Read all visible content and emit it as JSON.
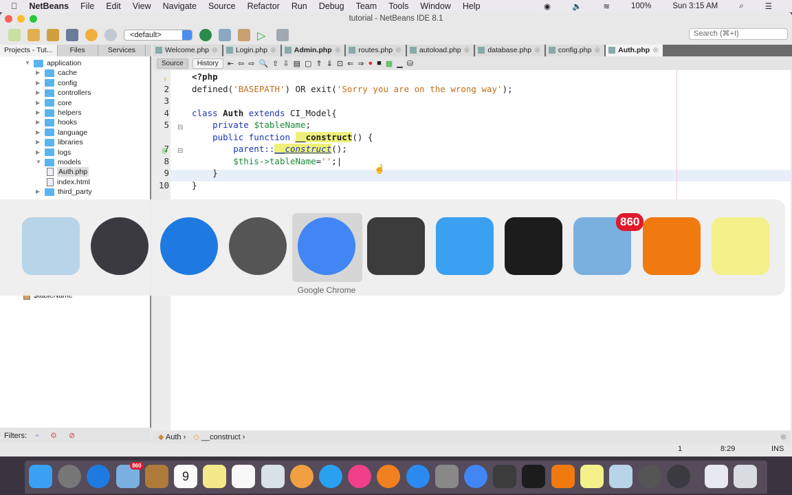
{
  "menubar": {
    "app": "NetBeans",
    "items": [
      "File",
      "Edit",
      "View",
      "Navigate",
      "Source",
      "Refactor",
      "Run",
      "Debug",
      "Team",
      "Tools",
      "Window",
      "Help"
    ],
    "battery": "100%",
    "clock": "Sun 3:15 AM"
  },
  "window": {
    "title": "tutorial - NetBeans IDE 8.1"
  },
  "toolbar": {
    "config": "<default>",
    "search_placeholder": "Search (⌘+I)"
  },
  "left_tabs": [
    "Projects - Tut...",
    "Files",
    "Services"
  ],
  "tree": [
    {
      "label": "application",
      "type": "folder",
      "depth": 0,
      "open": true
    },
    {
      "label": "cache",
      "type": "folder",
      "depth": 1
    },
    {
      "label": "config",
      "type": "folder",
      "depth": 1
    },
    {
      "label": "controllers",
      "type": "folder",
      "depth": 1
    },
    {
      "label": "core",
      "type": "folder",
      "depth": 1
    },
    {
      "label": "helpers",
      "type": "folder",
      "depth": 1
    },
    {
      "label": "hooks",
      "type": "folder",
      "depth": 1
    },
    {
      "label": "language",
      "type": "folder",
      "depth": 1
    },
    {
      "label": "libraries",
      "type": "folder",
      "depth": 1
    },
    {
      "label": "logs",
      "type": "folder",
      "depth": 1
    },
    {
      "label": "models",
      "type": "folder",
      "depth": 1,
      "open": true
    },
    {
      "label": "Auth.php",
      "type": "file",
      "depth": 2,
      "selected": true
    },
    {
      "label": "index.html",
      "type": "file",
      "depth": 2
    },
    {
      "label": "third_party",
      "type": "folder",
      "depth": 1
    }
  ],
  "navigator": {
    "item": "$tableName"
  },
  "filters_label": "Filters:",
  "editor_tabs": [
    {
      "label": "Welcome.php"
    },
    {
      "label": "Login.php"
    },
    {
      "label": "Admin.php",
      "bold": true
    },
    {
      "label": "routes.php"
    },
    {
      "label": "autoload.php"
    },
    {
      "label": "database.php"
    },
    {
      "label": "config.php"
    },
    {
      "label": "Auth.php",
      "active": true
    }
  ],
  "editor_tools": {
    "source": "Source",
    "history": "History"
  },
  "code": {
    "line_numbers": [
      "",
      "2",
      "3",
      "4",
      "5",
      "",
      "7",
      "8",
      "9",
      "10"
    ],
    "lines": [
      [
        {
          "t": "<?php",
          "c": "b"
        }
      ],
      [
        {
          "t": "defined("
        },
        {
          "t": "'BASEPATH'",
          "c": "str"
        },
        {
          "t": ") OR exit("
        },
        {
          "t": "'Sorry you are on the wrong way'",
          "c": "str"
        },
        {
          "t": ");"
        }
      ],
      [],
      [
        {
          "t": "class ",
          "c": "kw"
        },
        {
          "t": "Auth",
          "c": "b"
        },
        {
          "t": " extends ",
          "c": "kw"
        },
        {
          "t": "CI_Model{"
        }
      ],
      [
        {
          "t": "    private ",
          "c": "kw"
        },
        {
          "t": "$tableName",
          "c": "var"
        },
        {
          "t": ";"
        }
      ],
      [
        {
          "t": "    public function ",
          "c": "kw"
        },
        {
          "t": "__construct",
          "c": "b hl"
        },
        {
          "t": "() {"
        }
      ],
      [
        {
          "t": "        parent::",
          "c": "kw"
        },
        {
          "t": "__construct",
          "c": "kw it hl"
        },
        {
          "t": "();"
        }
      ],
      [
        {
          "t": "        $this->",
          "c": "var"
        },
        {
          "t": "tableName",
          "c": "var"
        },
        {
          "t": "="
        },
        {
          "t": "''",
          "c": "str"
        },
        {
          "t": ";|"
        }
      ],
      [
        {
          "t": "    }"
        }
      ],
      [
        {
          "t": "}"
        }
      ]
    ]
  },
  "breadcrumb": [
    "Auth",
    "__construct"
  ],
  "status": {
    "position": "8:29",
    "mode": "INS",
    "notifications": "1"
  },
  "switcher": {
    "selected_label": "Google Chrome",
    "apps": [
      {
        "name": "netbeans-icon",
        "color": "#b8d4e8"
      },
      {
        "name": "quicktime-icon",
        "color": "#3a3a40"
      },
      {
        "name": "safari-icon",
        "color": "#1e7ae0"
      },
      {
        "name": "mamp-icon",
        "color": "#555555"
      },
      {
        "name": "chrome-icon",
        "color": "#4285f4"
      },
      {
        "name": "sublime-text-icon",
        "color": "#3c3c3c"
      },
      {
        "name": "finder-icon",
        "color": "#3aa0f0"
      },
      {
        "name": "terminal-icon",
        "color": "#1c1c1c"
      },
      {
        "name": "mail-icon",
        "color": "#7ab0e0",
        "badge": "860"
      },
      {
        "name": "messaging-app-icon",
        "color": "#f07a10"
      },
      {
        "name": "stickies-icon",
        "color": "#f4f08a"
      }
    ]
  },
  "dock": {
    "mail_badge": "860",
    "calendar_day": "9",
    "apps": [
      {
        "name": "finder-icon",
        "color": "#3aa0f0"
      },
      {
        "name": "launchpad-icon",
        "color": "#777"
      },
      {
        "name": "safari-icon",
        "color": "#1e7ae0"
      },
      {
        "name": "mail-icon",
        "color": "#7ab0e0"
      },
      {
        "name": "contacts-icon",
        "color": "#b07a3a"
      },
      {
        "name": "calendar-icon",
        "color": "#fafafa"
      },
      {
        "name": "notes-icon",
        "color": "#f4e88a"
      },
      {
        "name": "reminders-icon",
        "color": "#f8f8f8"
      },
      {
        "name": "preview-icon",
        "color": "#d8e0e8"
      },
      {
        "name": "photos-icon",
        "color": "#f0a040"
      },
      {
        "name": "messages-icon",
        "color": "#2aa0f0"
      },
      {
        "name": "itunes-icon",
        "color": "#f0408a"
      },
      {
        "name": "ibooks-icon",
        "color": "#f08020"
      },
      {
        "name": "app-store-icon",
        "color": "#2a8af0"
      },
      {
        "name": "system-preferences-icon",
        "color": "#888"
      },
      {
        "name": "chrome-icon",
        "color": "#4285f4"
      },
      {
        "name": "sublime-text-icon",
        "color": "#3c3c3c"
      },
      {
        "name": "terminal-icon",
        "color": "#1c1c1c"
      },
      {
        "name": "messaging-app-icon",
        "color": "#f07a10"
      },
      {
        "name": "stickies-icon",
        "color": "#f4f08a"
      },
      {
        "name": "netbeans-icon",
        "color": "#b8d4e8"
      },
      {
        "name": "mamp-icon",
        "color": "#555"
      },
      {
        "name": "quicktime-icon",
        "color": "#3a3a40"
      },
      {
        "name": "downloads-stack-icon",
        "color": "#e8e8f0"
      },
      {
        "name": "trash-icon",
        "color": "#d8dce0"
      }
    ]
  }
}
